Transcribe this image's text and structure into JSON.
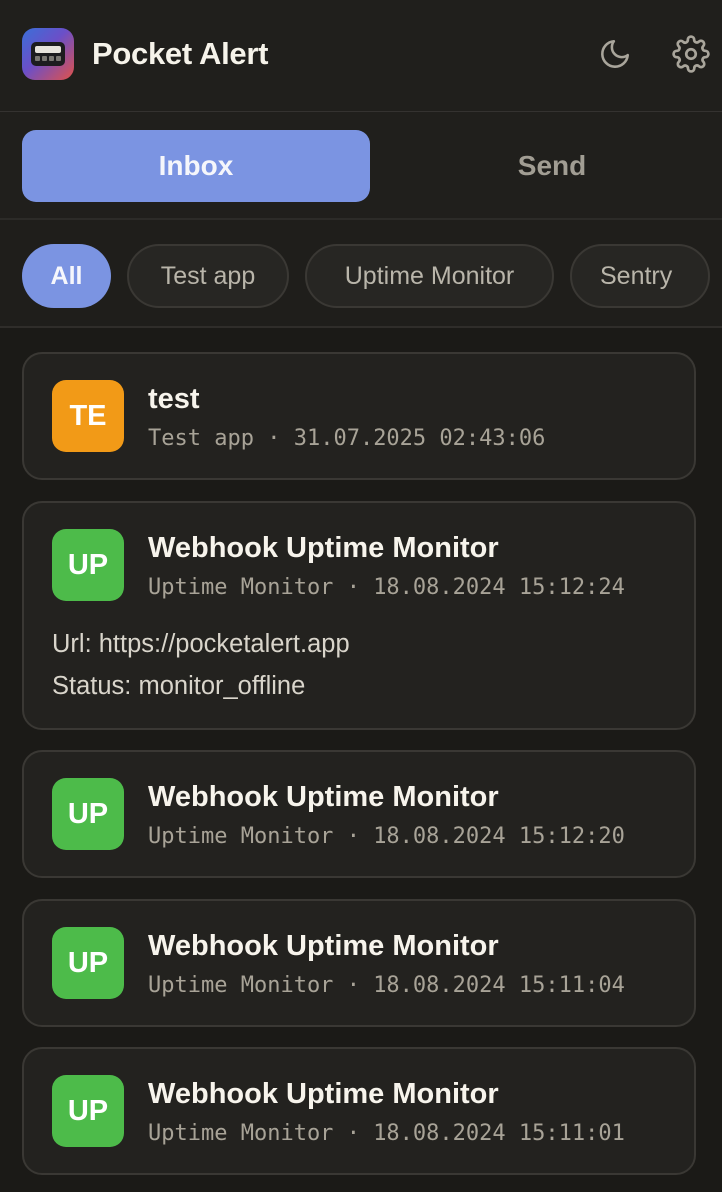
{
  "app": {
    "title": "Pocket Alert",
    "logo_icon": "pager-icon"
  },
  "header": {
    "theme_icon": "moon-icon",
    "settings_icon": "gear-icon"
  },
  "tabs": [
    {
      "label": "Inbox",
      "active": true
    },
    {
      "label": "Send",
      "active": false
    }
  ],
  "filters": [
    {
      "label": "All",
      "active": true
    },
    {
      "label": "Test app",
      "active": false
    },
    {
      "label": "Uptime Monitor",
      "active": false
    },
    {
      "label": "Sentry",
      "active": false
    }
  ],
  "colors": {
    "accent": "#7b94e2",
    "avatar_test_app": "#f29a17",
    "avatar_uptime": "#4dbb4a",
    "background": "#1b1a17"
  },
  "messages": [
    {
      "avatar": "TE",
      "title": "test",
      "source": "Test app",
      "separator": "·",
      "timestamp": "31.07.2025 02:43:06"
    },
    {
      "avatar": "UP",
      "title": "Webhook Uptime Monitor",
      "source": "Uptime Monitor",
      "separator": "·",
      "timestamp": "18.08.2024 15:12:24",
      "body": [
        "Url: https://pocketalert.app",
        "Status: monitor_offline"
      ]
    },
    {
      "avatar": "UP",
      "title": "Webhook Uptime Monitor",
      "source": "Uptime Monitor",
      "separator": "·",
      "timestamp": "18.08.2024 15:12:20"
    },
    {
      "avatar": "UP",
      "title": "Webhook Uptime Monitor",
      "source": "Uptime Monitor",
      "separator": "·",
      "timestamp": "18.08.2024 15:11:04"
    },
    {
      "avatar": "UP",
      "title": "Webhook Uptime Monitor",
      "source": "Uptime Monitor",
      "separator": "·",
      "timestamp": "18.08.2024 15:11:01"
    }
  ]
}
